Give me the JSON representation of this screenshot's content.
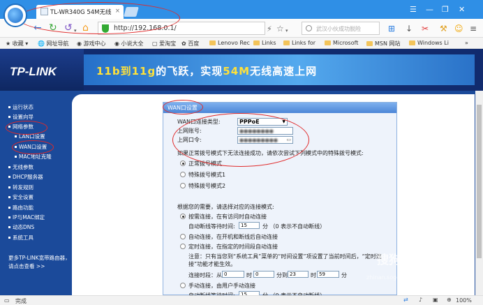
{
  "browser": {
    "tab_title": "TL-WR340G 54M无线",
    "url": "http://192.168.0.1/",
    "search_placeholder": "武汉小伙成功脱险",
    "status_text": "完成",
    "zoom": "100%"
  },
  "bookmarks": [
    "收藏",
    "网址导航",
    "游戏中心",
    "小说大全",
    "爱淘宝",
    "百度",
    "Lenovo Rec",
    "Links",
    "Links for",
    "Microsoft",
    "MSN 网站",
    "Windows Li"
  ],
  "banner": {
    "brand": "TP-LINK",
    "slogan_a": "11b到",
    "slogan_b": "11g",
    "slogan_c": "的飞跃，实现",
    "slogan_d": "54M",
    "slogan_e": "无线高速上网"
  },
  "sidebar": {
    "items": [
      "运行状态",
      "设置向导",
      "网络参数",
      "LAN口设置",
      "WAN口设置",
      "MAC地址克隆",
      "无线参数",
      "DHCP服务器",
      "转发规则",
      "安全设置",
      "路由功能",
      "IP与MAC绑定",
      "动态DNS",
      "系统工具"
    ],
    "note": "更多TP-LINK宽带路由器，请点击查看 >>"
  },
  "wan": {
    "header": "WAN口设置",
    "conn_type_label": "WAN口连接类型:",
    "conn_type_value": "PPPoE",
    "account_label": "上网账号:",
    "account_value": "●●●●●●●●",
    "password_label": "上网口令:",
    "password_value": "●●●●●●●●●",
    "dial_hint": "如果正常拨号模式下无法连接成功，请依次尝试下列模式中的特殊拨号模式:",
    "dial_modes": [
      "正常拨号模式",
      "特殊拨号模式1",
      "特殊拨号模式2"
    ],
    "conn_hint": "根据您的需要，请选择对应的连接模式:",
    "on_demand": "按需连接，在有访问时自动连接",
    "idle_label": "自动断线等待时间:",
    "idle_value": "15",
    "idle_unit": "分 （0 表示不自动断线）",
    "auto_connect": "自动连接，在开机和断线后自动连接",
    "timed_connect": "定时连接，在指定的时间段自动连接",
    "timed_note": "注意：只有当您到“系统工具”菜单的“时间设置”项设置了当前时间后，“定时连接”功能才能生效。",
    "period_label": "连接时段：从",
    "period_from_h": "0",
    "period_h": "时",
    "period_from_m": "0",
    "period_to": "分到",
    "period_to_h": "23",
    "period_h2": "时",
    "period_to_m": "59",
    "period_m": "分",
    "manual_connect": "手动连接，由用户手动连接",
    "manual_idle_value": "15"
  },
  "watermark": "搜狗指南",
  "watermark_url": "zhinan.sogou.com"
}
